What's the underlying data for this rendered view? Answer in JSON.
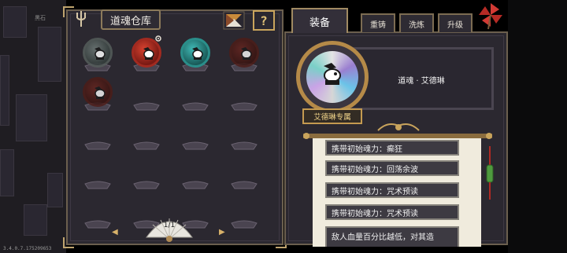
{
  "version": "3.4.0.7.175209653",
  "background": {
    "label": "黑石"
  },
  "warehouse": {
    "title": "道魂仓库",
    "help_label": "?",
    "page": "1/1",
    "slots": [
      {
        "state": "gray"
      },
      {
        "state": "red",
        "badge": "flower-icon"
      },
      {
        "state": "teal"
      },
      {
        "state": "dark"
      },
      {
        "state": "dark"
      },
      {
        "state": "empty"
      },
      {
        "state": "empty"
      },
      {
        "state": "empty"
      },
      {
        "state": "empty"
      },
      {
        "state": "empty"
      },
      {
        "state": "empty"
      },
      {
        "state": "empty"
      },
      {
        "state": "empty"
      },
      {
        "state": "empty"
      },
      {
        "state": "empty"
      },
      {
        "state": "empty"
      },
      {
        "state": "empty"
      },
      {
        "state": "empty"
      },
      {
        "state": "empty"
      },
      {
        "state": "empty"
      }
    ]
  },
  "tabs": [
    "装备",
    "重铸",
    "洗炼",
    "升级"
  ],
  "equip": {
    "soul_name": "道魂 · 艾德琳",
    "exclusive_label": "艾德琳专属",
    "effects": [
      "携带初始魂力：癫狂",
      "携带初始魂力：回荡余波",
      "携带初始魂力：咒术预读",
      "携带初始魂力：咒术预读",
      "敌人血量百分比越低，对其造"
    ]
  },
  "colors": {
    "frame": "#6b5f4e",
    "gold": "#c9a45c",
    "panel": "#2b2830",
    "paper": "#f0ebdd"
  }
}
